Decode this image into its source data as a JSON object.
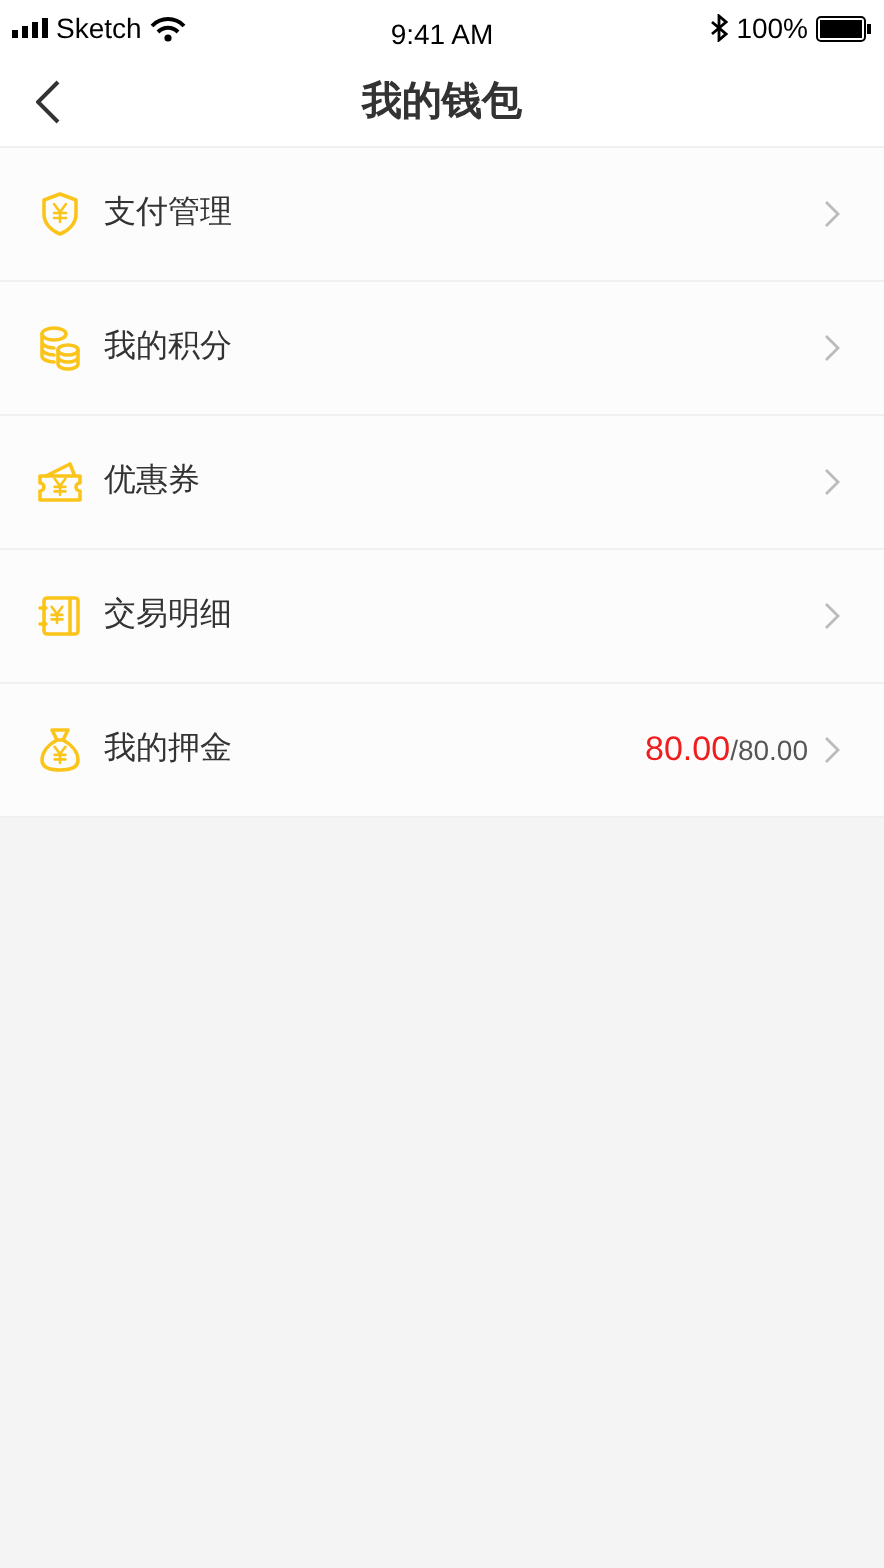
{
  "status_bar": {
    "carrier": "Sketch",
    "time": "9:41 AM",
    "battery": "100%"
  },
  "nav": {
    "title": "我的钱包"
  },
  "items": [
    {
      "kind": "shield",
      "label": "支付管理"
    },
    {
      "kind": "coins",
      "label": "我的积分"
    },
    {
      "kind": "ticket",
      "label": "优惠券"
    },
    {
      "kind": "ledger",
      "label": "交易明细"
    },
    {
      "kind": "bag",
      "label": "我的押金",
      "value": "80.00",
      "total": "/80.00"
    }
  ]
}
